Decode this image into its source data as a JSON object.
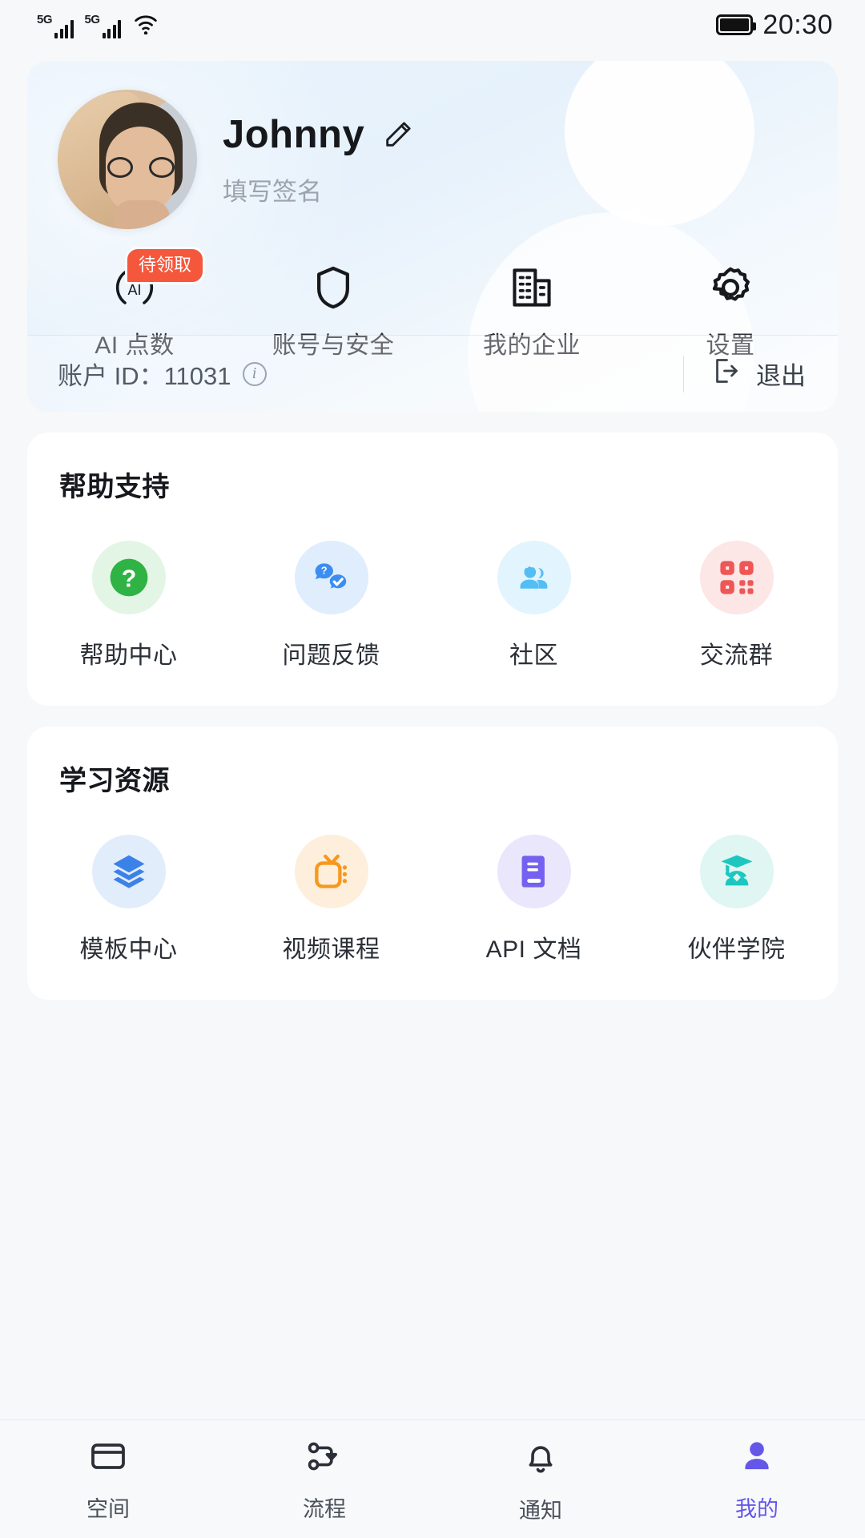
{
  "status_bar": {
    "network_1": "5G",
    "network_2": "5G",
    "wifi_icon": "wifi-icon",
    "battery_icon": "battery-icon",
    "time": "20:30"
  },
  "profile": {
    "avatar_name": "avatar",
    "user_name": "Johnny",
    "edit_icon": "pencil-edit-icon",
    "signature_placeholder": "填写签名",
    "quick_actions": [
      {
        "icon": "ai-points-icon",
        "label": "AI 点数",
        "badge": "待领取"
      },
      {
        "icon": "shield-icon",
        "label": "账号与安全",
        "badge": ""
      },
      {
        "icon": "building-icon",
        "label": "我的企业",
        "badge": ""
      },
      {
        "icon": "gear-icon",
        "label": "设置",
        "badge": ""
      }
    ],
    "account": {
      "id_label": "账户 ID：11031",
      "info_icon": "info-icon",
      "logout_icon": "logout-icon",
      "logout_label": "退出"
    }
  },
  "help_section": {
    "title": "帮助支持",
    "items": [
      {
        "icon": "question-mark-icon",
        "label": "帮助中心",
        "bg": "#E3F5E5",
        "fg": "#2FB344"
      },
      {
        "icon": "chat-feedback-icon",
        "label": "问题反馈",
        "bg": "#DFEDFC",
        "fg": "#3B8EF0"
      },
      {
        "icon": "community-people-icon",
        "label": "社区",
        "bg": "#E2F4FD",
        "fg": "#53BDF5"
      },
      {
        "icon": "qr-code-icon",
        "label": "交流群",
        "bg": "#FCE6E6",
        "fg": "#EF5656"
      }
    ]
  },
  "learning_section": {
    "title": "学习资源",
    "items": [
      {
        "icon": "layers-icon",
        "label": "模板中心",
        "bg": "#E2EDFB",
        "fg": "#3B82E8"
      },
      {
        "icon": "tv-icon",
        "label": "视频课程",
        "bg": "#FDEFDC",
        "fg": "#F7981E"
      },
      {
        "icon": "book-icon",
        "label": "API 文档",
        "bg": "#EAE7FC",
        "fg": "#7461F0"
      },
      {
        "icon": "graduation-cap-icon",
        "label": "伙伴学院",
        "bg": "#DFF6F2",
        "fg": "#1DC7C0"
      }
    ]
  },
  "tab_bar": {
    "active_color": "#6457E8",
    "tabs": [
      {
        "icon": "space-box-icon",
        "label": "空间",
        "active": false
      },
      {
        "icon": "flow-icon",
        "label": "流程",
        "active": false
      },
      {
        "icon": "bell-icon",
        "label": "通知",
        "active": false
      },
      {
        "icon": "person-icon",
        "label": "我的",
        "active": true
      }
    ]
  }
}
